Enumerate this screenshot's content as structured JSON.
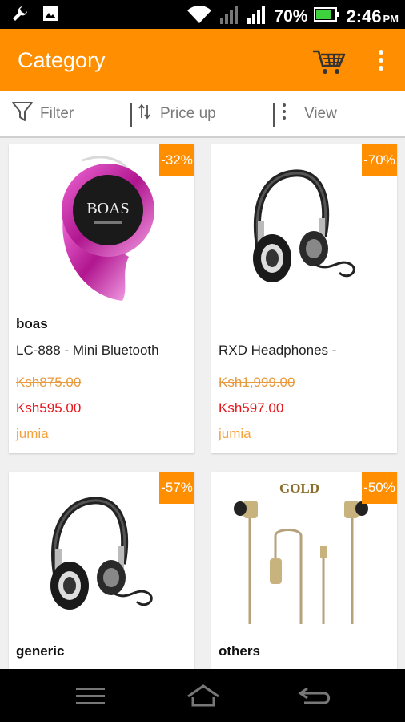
{
  "status_bar": {
    "battery": "70%",
    "time": "2:46",
    "ampm": "PM"
  },
  "app_bar": {
    "title": "Category"
  },
  "toolbar": {
    "filter": "Filter",
    "sort": "Price up",
    "view": "View"
  },
  "products": [
    {
      "discount": "-32%",
      "brand": "boas",
      "name": "LC-888 - Mini Bluetooth",
      "old_price": "Ksh875.00",
      "price": "Ksh595.00",
      "store": "jumia",
      "image_text": "BOAS"
    },
    {
      "discount": "-70%",
      "brand": "",
      "name": "RXD Headphones -",
      "old_price": "Ksh1,999.00",
      "price": "Ksh597.00",
      "store": "jumia"
    },
    {
      "discount": "-57%",
      "brand": "generic"
    },
    {
      "discount": "-50%",
      "brand": "others",
      "image_text": "GOLD"
    }
  ],
  "icons": {
    "status_left": [
      "wrench-icon",
      "image-icon"
    ],
    "status_right": [
      "wifi-icon",
      "signal-icon",
      "signal-icon",
      "battery-icon"
    ],
    "app_bar": [
      "cart-icon",
      "overflow-menu-icon"
    ],
    "toolbar": [
      "filter-icon",
      "sort-icon",
      "view-icon"
    ],
    "nav_bar": [
      "menu-icon",
      "home-icon",
      "back-icon"
    ]
  },
  "colors": {
    "accent": "#ff8f00",
    "price_red": "#e8151b",
    "old_price": "#e89a3c",
    "store": "#f4a23c"
  }
}
